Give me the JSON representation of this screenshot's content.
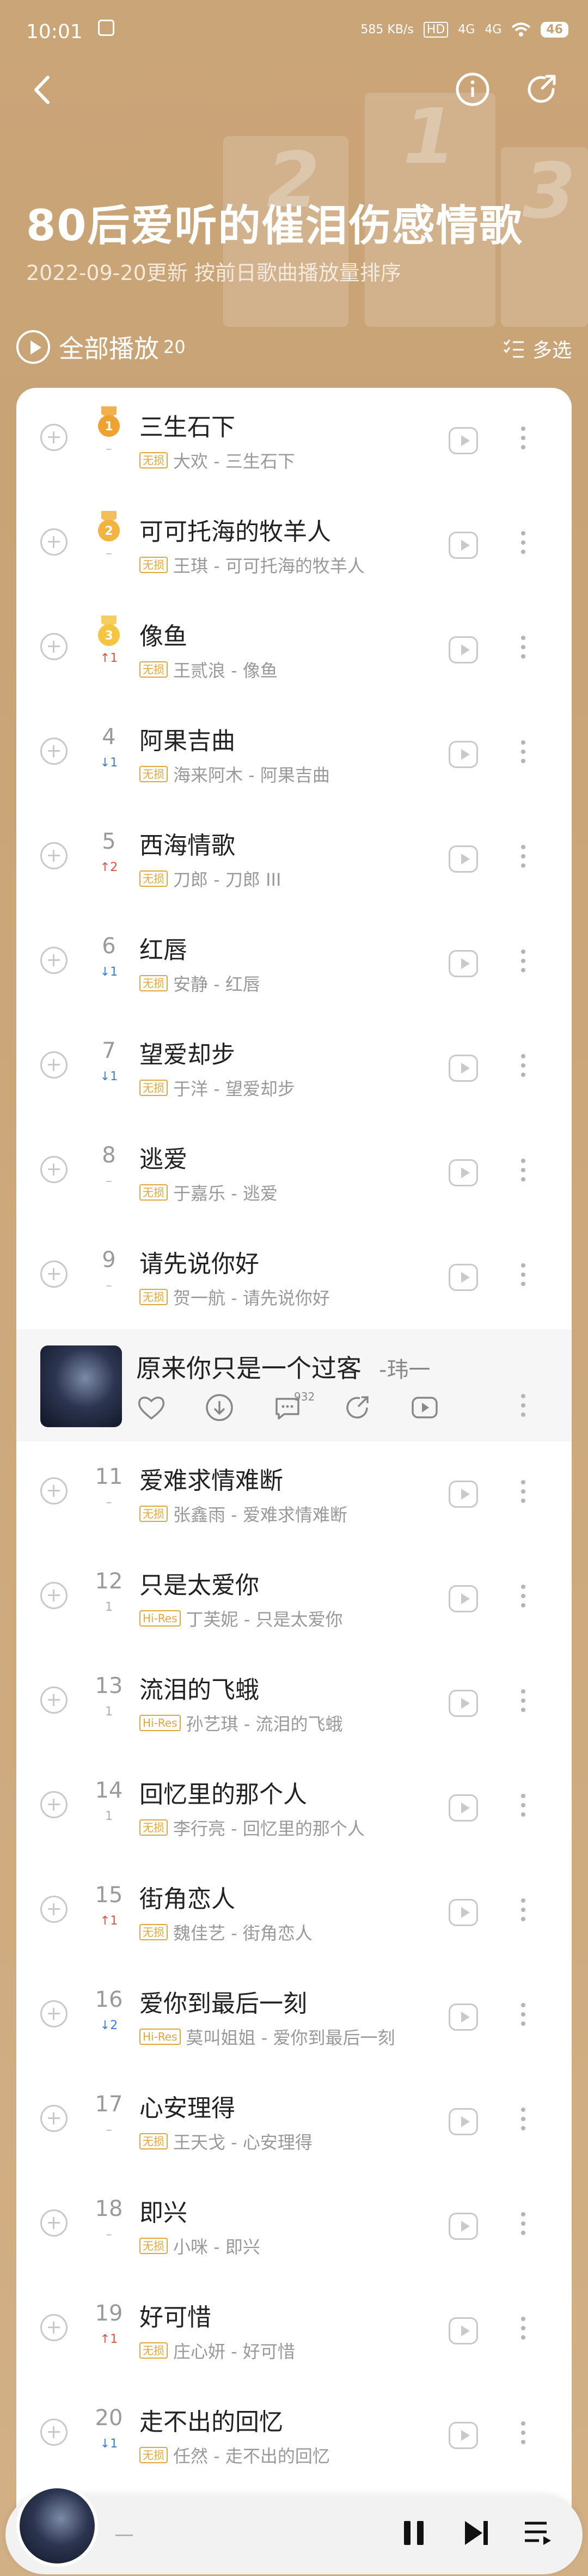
{
  "status_bar": {
    "time": "10:01",
    "speed": "585 KB/s",
    "hd": "HD",
    "net1": "4G",
    "net2": "4G",
    "battery": "46"
  },
  "header": {
    "title": "80后爱听的催泪伤感情歌",
    "subtitle": "2022-09-20更新 按前日歌曲播放量排序",
    "play_all": "全部播放",
    "count": "20",
    "multi_select": "多选",
    "podium": [
      "2",
      "1",
      "3"
    ]
  },
  "tag_labels": {
    "lossless": "无损",
    "hires": "Hi-Res"
  },
  "songs": [
    {
      "rank": "1",
      "trend": "–",
      "trend_dir": "flat",
      "title": "三生石下",
      "tag": "无损",
      "meta": "大欢 - 三生石下",
      "medal": "gold"
    },
    {
      "rank": "2",
      "trend": "–",
      "trend_dir": "flat",
      "title": "可可托海的牧羊人",
      "tag": "无损",
      "meta": "王琪 - 可可托海的牧羊人",
      "medal": "silver"
    },
    {
      "rank": "3",
      "trend": "↑1",
      "trend_dir": "up",
      "title": "像鱼",
      "tag": "无损",
      "meta": "王贰浪 - 像鱼",
      "medal": "bronze"
    },
    {
      "rank": "4",
      "trend": "↓1",
      "trend_dir": "down",
      "title": "阿果吉曲",
      "tag": "无损",
      "meta": "海来阿木 - 阿果吉曲",
      "medal": ""
    },
    {
      "rank": "5",
      "trend": "↑2",
      "trend_dir": "up",
      "title": "西海情歌",
      "tag": "无损",
      "meta": "刀郎 - 刀郎 III",
      "medal": ""
    },
    {
      "rank": "6",
      "trend": "↓1",
      "trend_dir": "down",
      "title": "红唇",
      "tag": "无损",
      "meta": "安静 - 红唇",
      "medal": ""
    },
    {
      "rank": "7",
      "trend": "↓1",
      "trend_dir": "down",
      "title": "望爱却步",
      "tag": "无损",
      "meta": "于洋 - 望爱却步",
      "medal": ""
    },
    {
      "rank": "8",
      "trend": "–",
      "trend_dir": "flat",
      "title": "逃爱",
      "tag": "无损",
      "meta": "于嘉乐 - 逃爱",
      "medal": ""
    },
    {
      "rank": "9",
      "trend": "–",
      "trend_dir": "flat",
      "title": "请先说你好",
      "tag": "无损",
      "meta": "贺一航 - 请先说你好",
      "medal": ""
    },
    {
      "rank": "11",
      "trend": "–",
      "trend_dir": "flat",
      "title": "爱难求情难断",
      "tag": "无损",
      "meta": "张鑫雨 - 爱难求情难断",
      "medal": ""
    },
    {
      "rank": "12",
      "trend": "1",
      "trend_dir": "flat",
      "title": "只是太爱你",
      "tag": "Hi-Res",
      "meta": "丁芙妮 - 只是太爱你",
      "medal": ""
    },
    {
      "rank": "13",
      "trend": "1",
      "trend_dir": "flat",
      "title": "流泪的飞蛾",
      "tag": "Hi-Res",
      "meta": "孙艺琪 - 流泪的飞蛾",
      "medal": ""
    },
    {
      "rank": "14",
      "trend": "1",
      "trend_dir": "flat",
      "title": "回忆里的那个人",
      "tag": "无损",
      "meta": "李行亮 - 回忆里的那个人",
      "medal": ""
    },
    {
      "rank": "15",
      "trend": "↑1",
      "trend_dir": "up",
      "title": "街角恋人",
      "tag": "无损",
      "meta": "魏佳艺 - 街角恋人",
      "medal": ""
    },
    {
      "rank": "16",
      "trend": "↓2",
      "trend_dir": "down",
      "title": "爱你到最后一刻",
      "tag": "Hi-Res",
      "meta": "莫叫姐姐 - 爱你到最后一刻",
      "medal": ""
    },
    {
      "rank": "17",
      "trend": "–",
      "trend_dir": "flat",
      "title": "心安理得",
      "tag": "无损",
      "meta": "王天戈 - 心安理得",
      "medal": ""
    },
    {
      "rank": "18",
      "trend": "–",
      "trend_dir": "flat",
      "title": "即兴",
      "tag": "无损",
      "meta": "小咪 - 即兴",
      "medal": ""
    },
    {
      "rank": "19",
      "trend": "↑1",
      "trend_dir": "up",
      "title": "好可惜",
      "tag": "无损",
      "meta": "庄心妍 - 好可惜",
      "medal": ""
    },
    {
      "rank": "20",
      "trend": "↓1",
      "trend_dir": "down",
      "title": "走不出的回忆",
      "tag": "无损",
      "meta": "任然 - 走不出的回忆",
      "medal": ""
    }
  ],
  "expanded_song": {
    "title": "原来你只是一个过客",
    "artist": "-玮一",
    "comment_count": "932"
  },
  "player": {
    "now_playing": "—"
  },
  "colors": {
    "background": "#c8a376",
    "tag": "#e2a73a",
    "trend_up": "#e3503c",
    "trend_down": "#3a7cd8"
  }
}
